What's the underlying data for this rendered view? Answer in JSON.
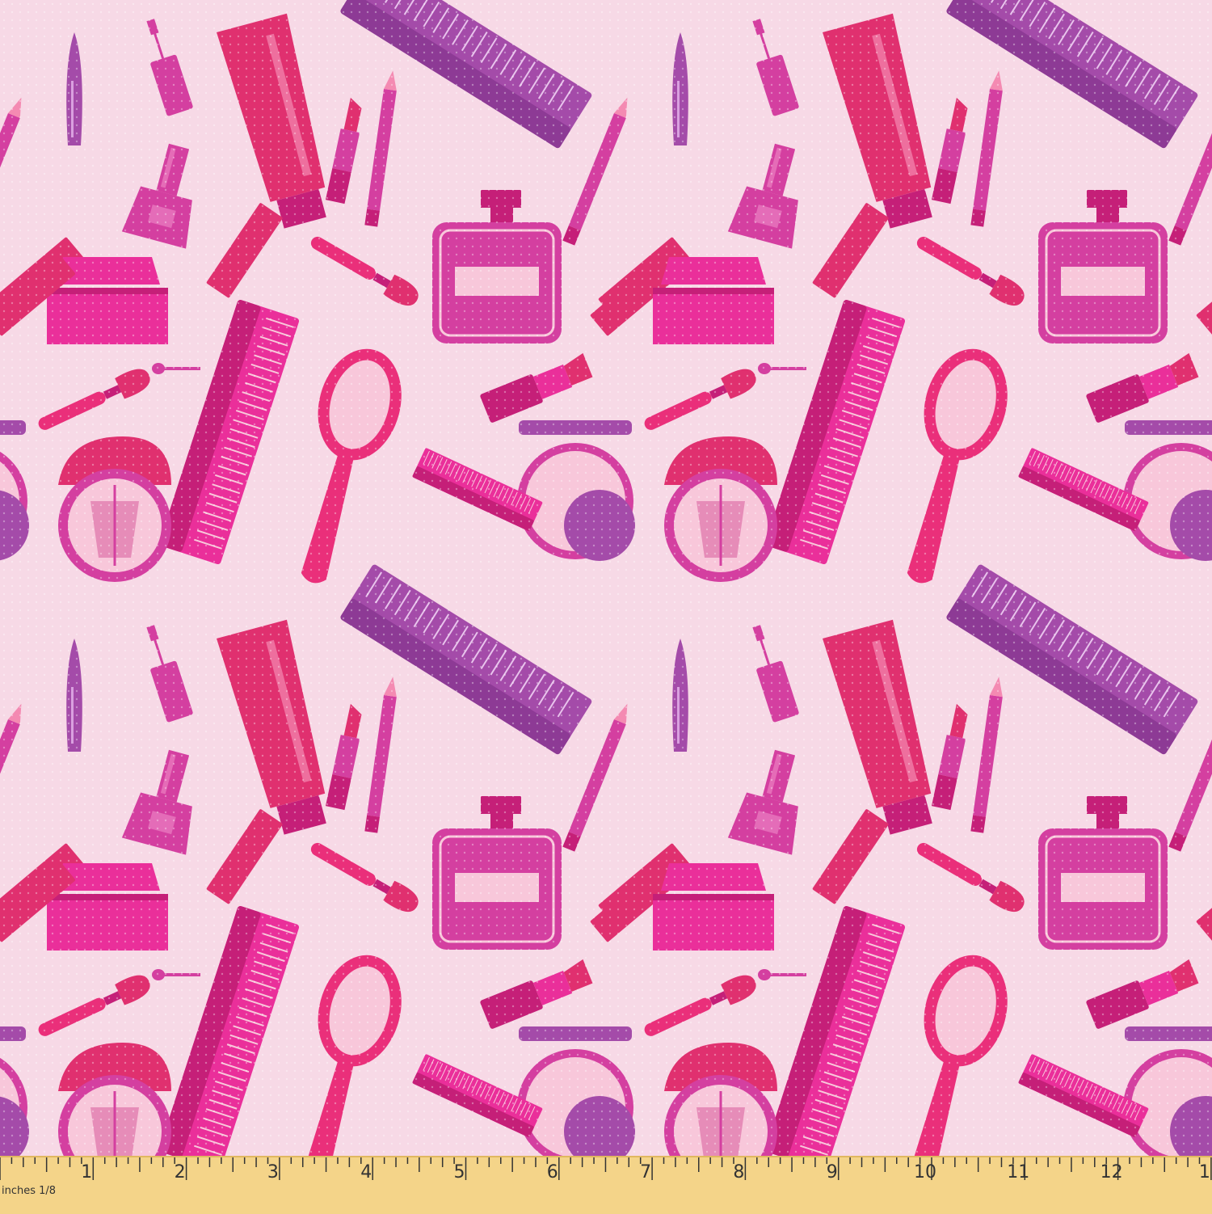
{
  "fabric": {
    "background_color": "#f7d9e6",
    "colors": {
      "hot_pink": "#ea2f9a",
      "raspberry": "#e0306f",
      "magenta": "#d43fa0",
      "purple": "#a44ba9",
      "deep_pink": "#c51f78",
      "pale_pink": "#f8c7da"
    },
    "motifs": [
      "comb-icon",
      "cream-tube-icon",
      "mascara-icon",
      "nail-polish-icon",
      "perfume-bottle-icon",
      "hand-mirror-icon",
      "powder-compact-icon",
      "lipstick-icon",
      "makeup-brush-icon",
      "eyeliner-pencil-icon",
      "cream-jar-icon",
      "eyeshadow-applicator-icon"
    ]
  },
  "ruler": {
    "unit_label": "inches 1/8",
    "numbers": [
      "1",
      "2",
      "3",
      "4",
      "5",
      "6",
      "7",
      "8",
      "9",
      "10",
      "11",
      "12",
      "1"
    ],
    "background_color": "#f4d489"
  }
}
